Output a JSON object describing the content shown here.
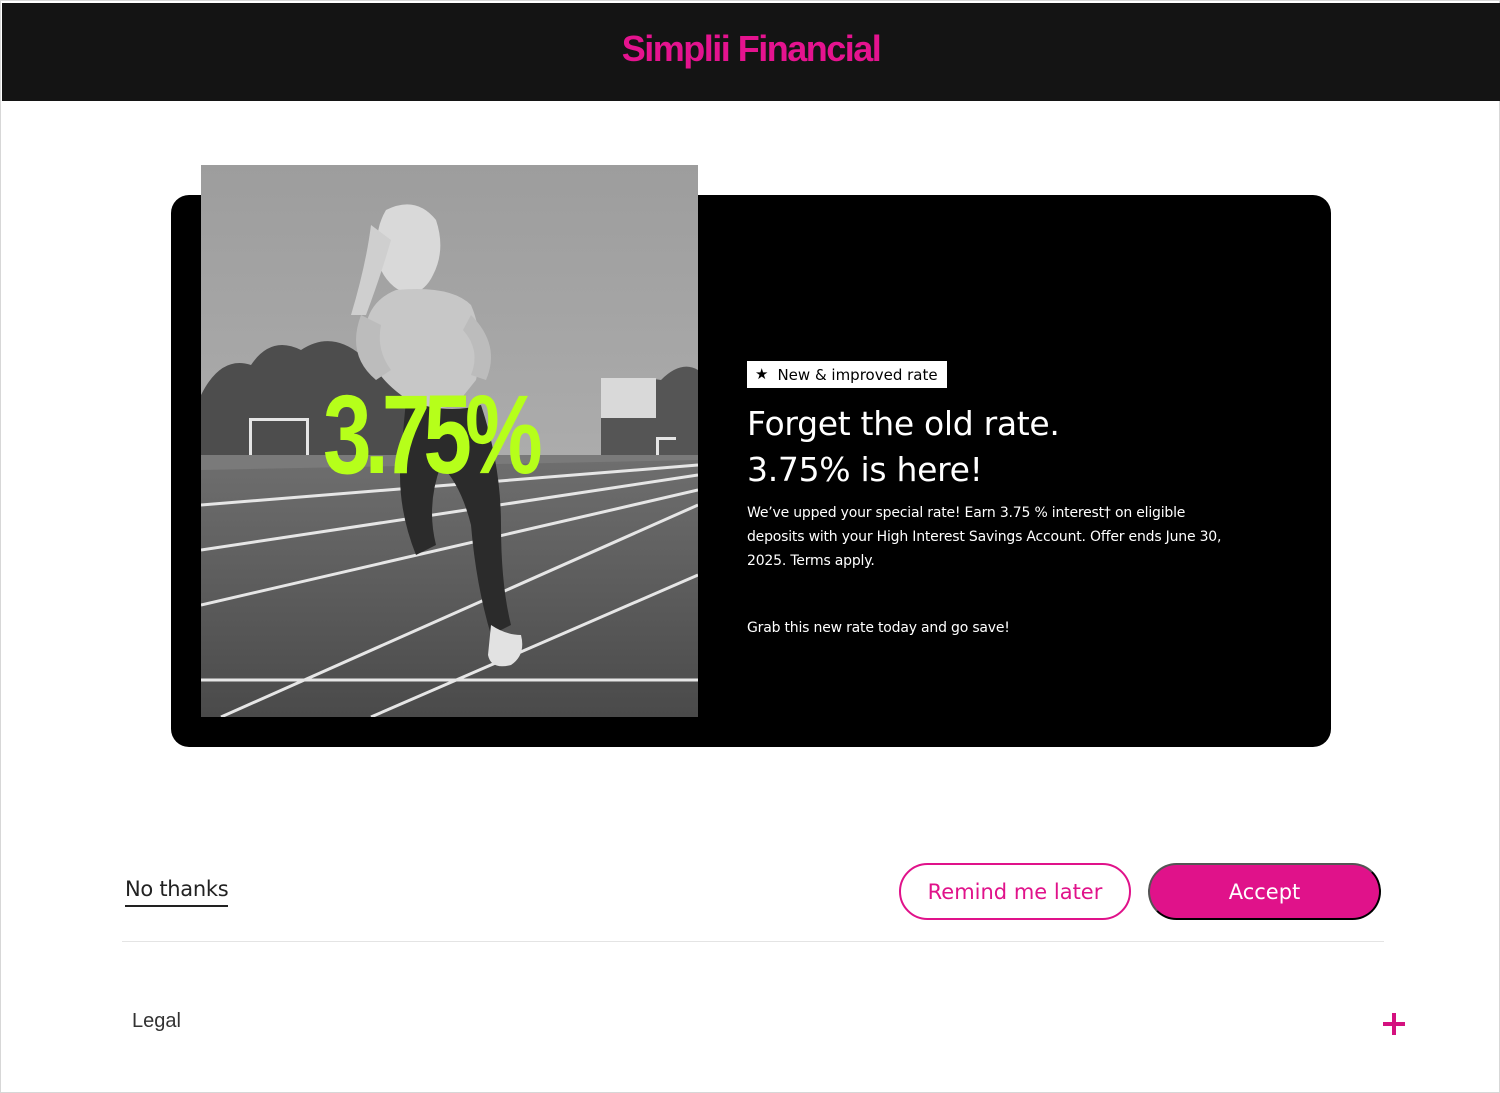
{
  "header": {
    "brand": "Simplii Financial"
  },
  "promo": {
    "hero_rate": "3.75%",
    "badge_label": "New & improved rate",
    "badge_icon": "star-icon",
    "headline_line1": "Forget the old rate.",
    "headline_line2": "3.75% is here!",
    "body": "We’ve upped your special rate! Earn 3.75 % interest† on eligible deposits with your High Interest Savings Account. Offer ends June 30, 2025. Terms apply.",
    "cta_text": "Grab this new rate today and go save!"
  },
  "actions": {
    "no_thanks": "No thanks",
    "remind_later": "Remind me later",
    "accept": "Accept"
  },
  "footer": {
    "legal_label": "Legal",
    "expand_icon": "plus-icon"
  },
  "colors": {
    "brand_pink": "#e0128a",
    "rate_green": "#b6ff1a",
    "header_bg": "#141414",
    "card_bg": "#000000"
  }
}
